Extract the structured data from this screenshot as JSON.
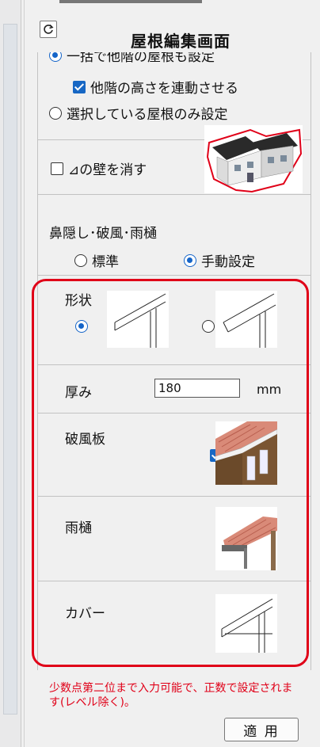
{
  "title": "屋根編集画面",
  "section1": {
    "cut_text": "一括で他階の屋根も設定",
    "link_heights_label": "他階の高さを連動させる",
    "link_heights_checked": true,
    "selected_only_label": "選択している屋根のみ設定",
    "selected_only_selected": false
  },
  "section2": {
    "hide_wall_label": "⊿の壁を消す",
    "hide_wall_checked": false
  },
  "section3": {
    "heading": "鼻隠し･破風･雨樋",
    "options": [
      {
        "label": "標準",
        "selected": false
      },
      {
        "label": "手動設定",
        "selected": true
      }
    ]
  },
  "shape": {
    "label": "形状",
    "options": [
      {
        "selected": true
      },
      {
        "selected": false
      }
    ]
  },
  "thickness": {
    "label": "厚み",
    "value": "180",
    "unit": "mm"
  },
  "barge_board": {
    "label": "破風板",
    "checked": true
  },
  "gutter": {
    "label": "雨樋",
    "checked": true
  },
  "cover": {
    "label": "カバー",
    "checked": false
  },
  "note": "少数点第二位まで入力可能で、正数で設定されます(レベル除く)。",
  "apply_label": "適 用",
  "colors": {
    "accent": "#1767c4",
    "highlight": "#e00018"
  }
}
